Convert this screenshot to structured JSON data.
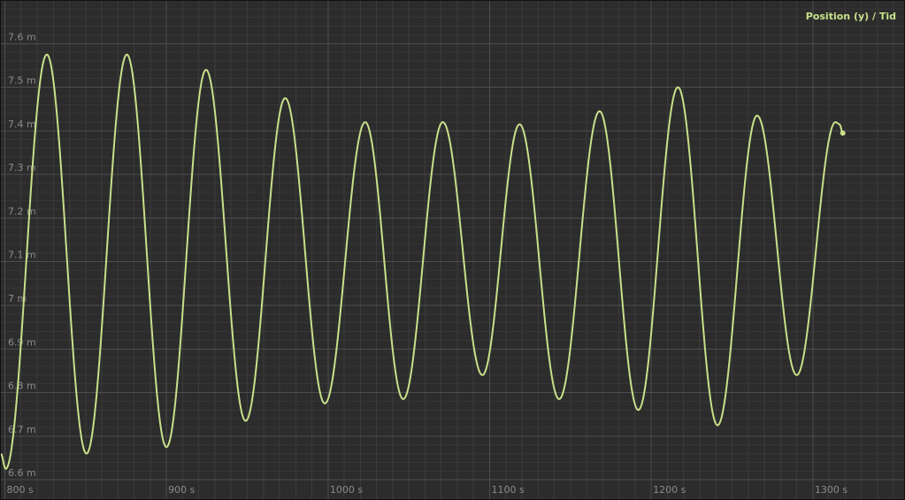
{
  "chart_data": {
    "type": "line",
    "legend": "Position (y) / Tid",
    "legend_position": "top-right",
    "grid": true,
    "xlim": [
      797,
      1357
    ],
    "ylim": [
      6.58,
      7.7
    ],
    "x_ticks": [
      {
        "value": 800,
        "label": "800 s"
      },
      {
        "value": 900,
        "label": "900 s"
      },
      {
        "value": 1000,
        "label": "1000 s"
      },
      {
        "value": 1100,
        "label": "1100 s"
      },
      {
        "value": 1200,
        "label": "1200 s"
      },
      {
        "value": 1300,
        "label": "1300 s"
      }
    ],
    "y_ticks": [
      {
        "value": 6.6,
        "label": "6.6 m"
      },
      {
        "value": 6.7,
        "label": "6.7 m"
      },
      {
        "value": 6.8,
        "label": "6.8 m"
      },
      {
        "value": 6.9,
        "label": "6.9 m"
      },
      {
        "value": 7.0,
        "label": "7 m"
      },
      {
        "value": 7.1,
        "label": "7.1 m"
      },
      {
        "value": 7.2,
        "label": "7.2 m"
      },
      {
        "value": 7.3,
        "label": "7.3 m"
      },
      {
        "value": 7.4,
        "label": "7.4 m"
      },
      {
        "value": 7.5,
        "label": "7.5 m"
      },
      {
        "value": 7.6,
        "label": "7.6 m"
      }
    ],
    "series": [
      {
        "color": "#c8e08a",
        "extrema": [
          {
            "x": 797.5,
            "y": 6.66
          },
          {
            "x": 800.5,
            "y": 6.625
          },
          {
            "x": 826,
            "y": 7.575
          },
          {
            "x": 850.5,
            "y": 6.66
          },
          {
            "x": 875.5,
            "y": 7.575
          },
          {
            "x": 900,
            "y": 6.675
          },
          {
            "x": 924.5,
            "y": 7.54
          },
          {
            "x": 949,
            "y": 6.735
          },
          {
            "x": 973.5,
            "y": 7.475
          },
          {
            "x": 998,
            "y": 6.775
          },
          {
            "x": 1023,
            "y": 7.42
          },
          {
            "x": 1046.5,
            "y": 6.785
          },
          {
            "x": 1071,
            "y": 7.42
          },
          {
            "x": 1095.5,
            "y": 6.84
          },
          {
            "x": 1118.5,
            "y": 7.415
          },
          {
            "x": 1143,
            "y": 6.785
          },
          {
            "x": 1168,
            "y": 7.445
          },
          {
            "x": 1192,
            "y": 6.76
          },
          {
            "x": 1216.5,
            "y": 7.5
          },
          {
            "x": 1241,
            "y": 6.725
          },
          {
            "x": 1265.5,
            "y": 7.435
          },
          {
            "x": 1290,
            "y": 6.84
          },
          {
            "x": 1314,
            "y": 7.42
          },
          {
            "x": 1316.5,
            "y": 7.415
          },
          {
            "x": 1318.5,
            "y": 7.395
          }
        ]
      }
    ]
  }
}
